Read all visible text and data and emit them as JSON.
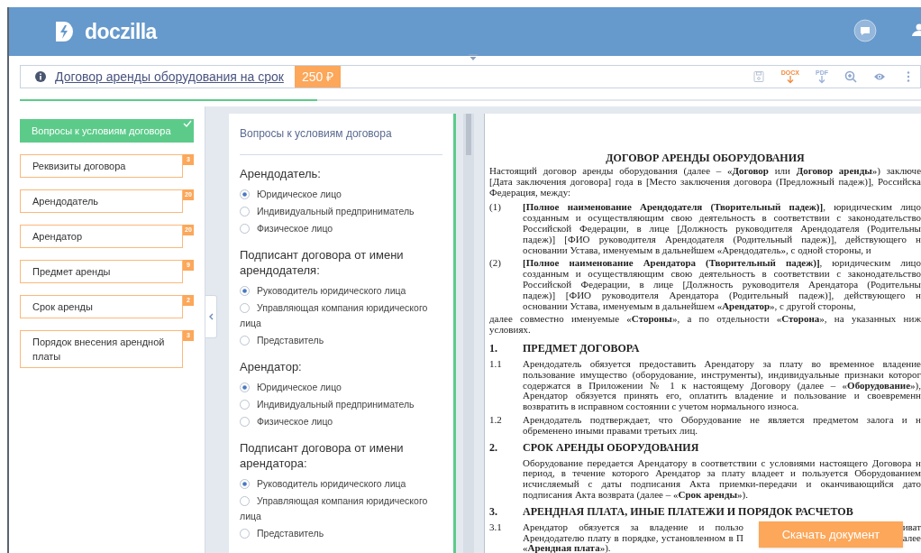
{
  "header": {
    "logo": "doczilla"
  },
  "toolbar": {
    "title": "Договор аренды оборудования на срок",
    "price": "250 ₽",
    "actions": [
      {
        "kind": "save"
      },
      {
        "kind": "docx",
        "label": "DOCX"
      },
      {
        "kind": "pdf",
        "label": "PDF"
      },
      {
        "kind": "zoom"
      },
      {
        "kind": "preview"
      },
      {
        "kind": "more"
      }
    ]
  },
  "progress": {
    "level": 0.33
  },
  "sidebar": {
    "items": [
      {
        "label": "Вопросы к условиям договора",
        "selected": true
      },
      {
        "label": "Реквизиты договора",
        "badge": "3",
        "selected": false
      },
      {
        "label": "Арендодатель",
        "badge": "20",
        "selected": false
      },
      {
        "label": "Арендатор",
        "badge": "20",
        "selected": false
      },
      {
        "label": "Предмет аренды",
        "badge": "9",
        "selected": false
      },
      {
        "label": "Срок аренды",
        "badge": "2",
        "selected": false
      },
      {
        "label": "Порядок внесения арендной платы",
        "badge": "3",
        "selected": false
      }
    ]
  },
  "form": {
    "title": "Вопросы к условиям договора",
    "groups": [
      {
        "question": "Арендодатель:",
        "options": [
          {
            "label": "Юридическое лицо",
            "selected": true
          },
          {
            "label": "Индивидуальный предприниматель",
            "selected": false
          },
          {
            "label": "Физическое лицо",
            "selected": false
          }
        ]
      },
      {
        "question": "Подписант договора от имени арендодателя:",
        "options": [
          {
            "label": "Руководитель юридического лица",
            "selected": true
          },
          {
            "label": "Управляющая компания юридического лица",
            "selected": false
          },
          {
            "label": "Представитель",
            "selected": false
          }
        ]
      },
      {
        "question": "Арендатор:",
        "options": [
          {
            "label": "Юридическое лицо",
            "selected": true
          },
          {
            "label": "Индивидуальный предприниматель",
            "selected": false
          },
          {
            "label": "Физическое лицо",
            "selected": false
          }
        ]
      },
      {
        "question": "Подписант договора от имени арендатора:",
        "options": [
          {
            "label": "Руководитель юридического лица",
            "selected": true
          },
          {
            "label": "Управляющая компания юридического лица",
            "selected": false
          },
          {
            "label": "Представитель",
            "selected": false
          }
        ]
      }
    ]
  },
  "document": {
    "title": "ДОГОВОР АРЕНДЫ ОБОРУДОВАНИЯ",
    "blocks": [
      {
        "kind": "paragraph",
        "lines": [
          "Настоящий договор аренды оборудования (далее – «**Договор** или **Договор аренды**») заключе",
          "[Дата заключения договора] года в [Место заключения договора (Предложный падеж)], Российска",
          "Федерация, между:"
        ]
      },
      {
        "kind": "item",
        "number": "(1)",
        "lines": [
          "**[Полное наименование Арендодателя (Творительный падеж)]**, юридическим лицо",
          "созданным и осуществляющим свою деятельность в соответствии с законодательство",
          "Российской Федерации, в лице [Должность руководителя Арендодателя (Родительны",
          "падеж)] [ФИО руководителя Арендодателя (Родительный падеж)], действующего н",
          "основании Устава, именуемым в дальнейшем «Арендодатель», с одной стороны, и"
        ]
      },
      {
        "kind": "item",
        "number": "(2)",
        "lines": [
          "**[Полное наименование Арендатора (Творительный падеж)]**, юридическим лицо",
          "созданным и осуществляющим свою деятельность в соответствии с законодательство",
          "Российской Федерации, в лице [Должность руководителя Арендатора (Родительны",
          "падеж)] [ФИО руководителя Арендатора (Родительный падеж)], действующего н",
          "основании Устава, именуемым в дальнейшем «**Арендатор**», с другой стороны,"
        ]
      },
      {
        "kind": "paragraph",
        "lines": [
          "далее совместно именуемые «**Стороны**», а по отдельности «**Сторона**», на указанных ниж",
          "условиях."
        ]
      },
      {
        "kind": "section",
        "number": "1.",
        "text": "ПРЕДМЕТ ДОГОВОРА"
      },
      {
        "kind": "item",
        "number": "1.1",
        "lines": [
          "Арендодатель обязуется предоставить Арендатору за плату во временное владение",
          "пользование имущество (оборудование, инструменты), индивидуальные признаки которог",
          "содержатся в Приложении № 1 к настоящему Договору (далее – «**Оборудование**»),",
          "Арендатор обязуется принять его, оплатить владение и пользование и своевременн",
          "возвратить в исправном состоянии с учетом нормального износа."
        ]
      },
      {
        "kind": "item",
        "number": "1.2",
        "lines": [
          "Арендодатель подтверждает, что Оборудование не является предметом залога и н",
          "обременено иными правами третьих лиц."
        ]
      },
      {
        "kind": "section",
        "number": "2.",
        "text": "СРОК АРЕНДЫ ОБОРУДОВАНИЯ"
      },
      {
        "kind": "item",
        "lines": [
          "Оборудование передается Арендатору в соответствии с условиями настоящего Договора н",
          "период, в течение которого Арендатор за плату владеет и пользуется Оборудованием",
          "исчисляемый с даты подписания Акта приемки-передачи и оканчивающийся дато",
          "подписания Акта возврата (далее – «**Срок аренды**»)."
        ]
      },
      {
        "kind": "section",
        "number": "3.",
        "text": "АРЕНДНАЯ ПЛАТА, ИНЫЕ ПЛАТЕЖИ И ПОРЯДОК РАСЧЕТОВ"
      },
      {
        "kind": "item",
        "number": "3.1",
        "lines": [
          {
            "left": "Арендатор обязуется за владение и пользо",
            "right": "иват"
          },
          {
            "left": "Арендодателю плату в порядке, установленном в П",
            "right": "алее"
          },
          "«**Арендная плата**»)."
        ]
      }
    ]
  },
  "download_button": "Скачать документ"
}
